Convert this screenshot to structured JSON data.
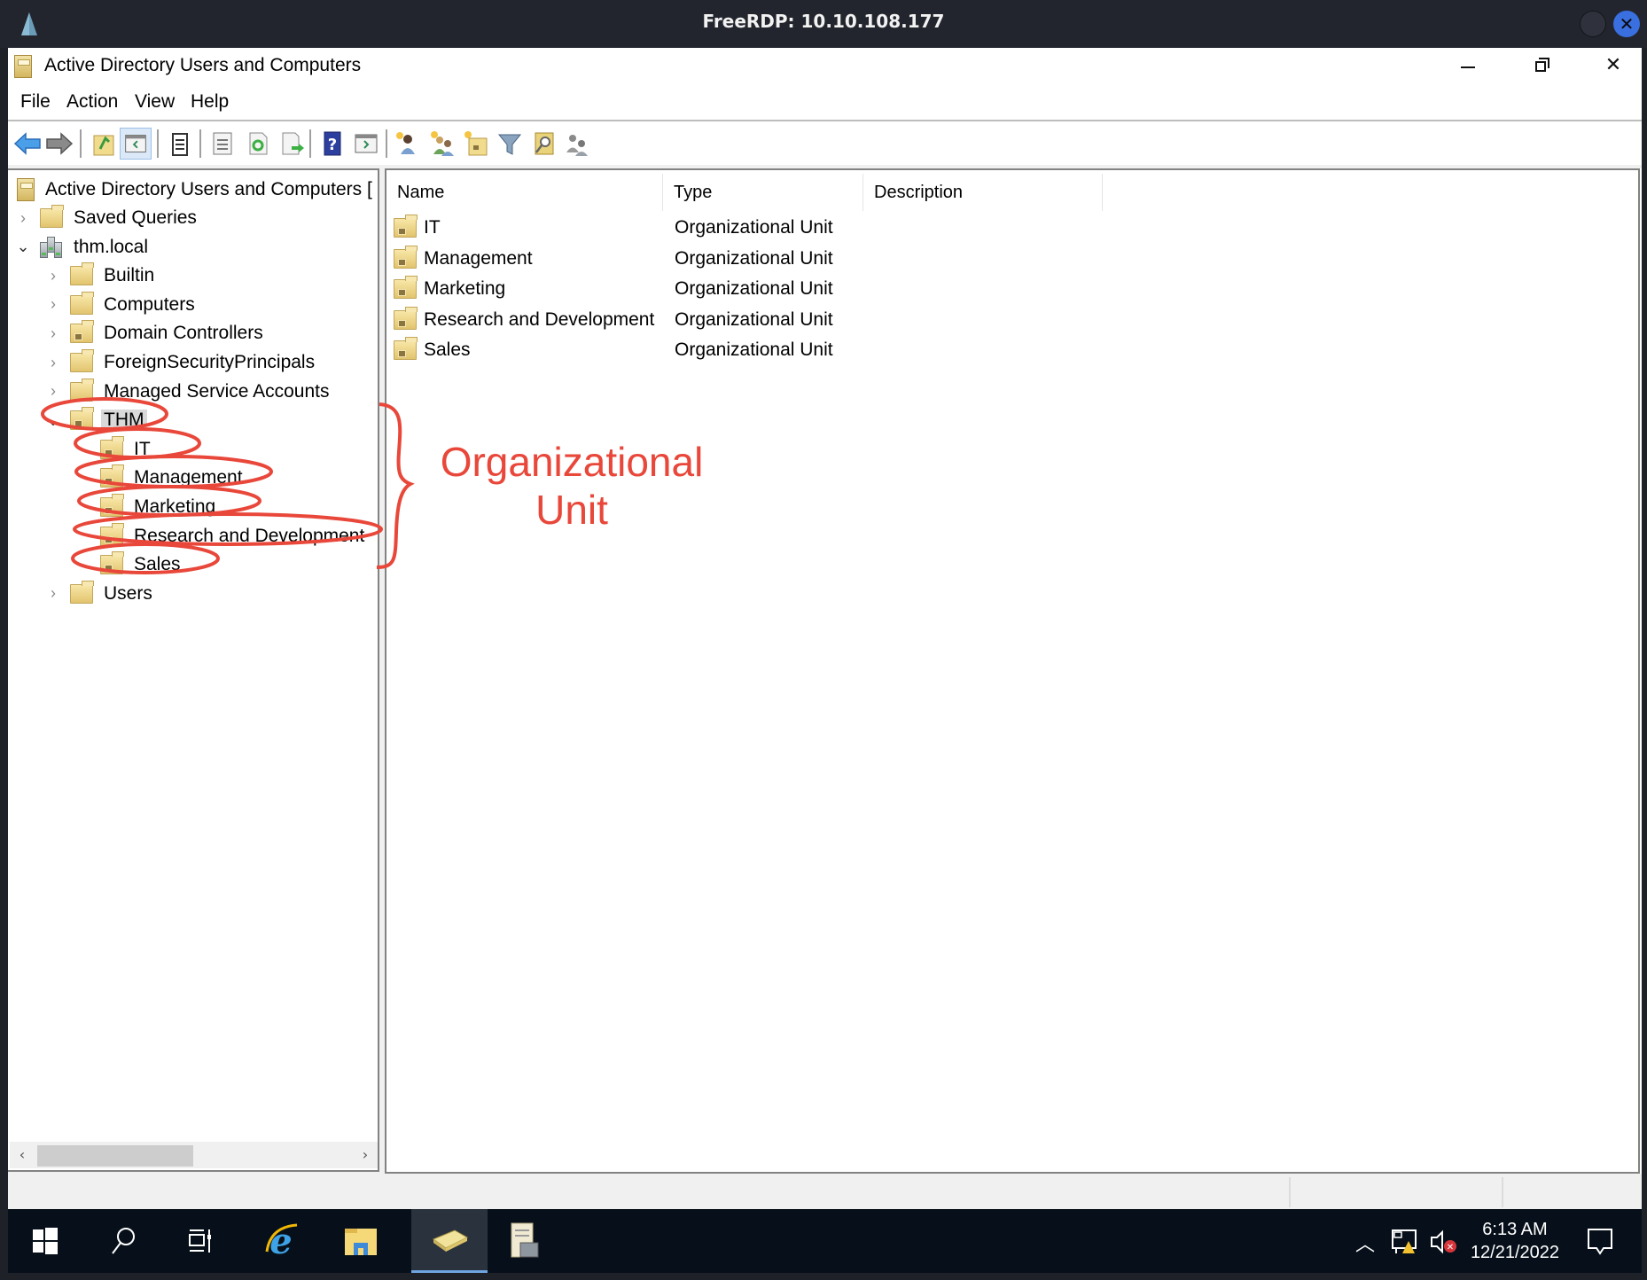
{
  "rdp": {
    "title": "FreeRDP: 10.10.108.177"
  },
  "window": {
    "title": "Active Directory Users and Computers",
    "controls": {
      "minimize": "minimize",
      "restore": "restore",
      "close": "close"
    }
  },
  "menu": [
    "File",
    "Action",
    "View",
    "Help"
  ],
  "toolbar": {
    "buttons": [
      "back-arrow",
      "forward-arrow",
      "up-folder",
      "show-hide-console-tree",
      "clipboard",
      "properties",
      "refresh",
      "export-list",
      "help",
      "show-hide-action-pane",
      "new-user",
      "new-group",
      "new-ou",
      "filter",
      "find",
      "add-to-group"
    ]
  },
  "tree": {
    "root": "Active Directory Users and Computers [",
    "items": [
      {
        "label": "Saved Queries",
        "level": 1,
        "expander": "collapsed",
        "icon": "folder"
      },
      {
        "label": "thm.local",
        "level": 1,
        "expander": "expanded",
        "icon": "domain"
      },
      {
        "label": "Builtin",
        "level": 2,
        "expander": "collapsed",
        "icon": "folder"
      },
      {
        "label": "Computers",
        "level": 2,
        "expander": "collapsed",
        "icon": "folder"
      },
      {
        "label": "Domain Controllers",
        "level": 2,
        "expander": "collapsed",
        "icon": "ou"
      },
      {
        "label": "ForeignSecurityPrincipals",
        "level": 2,
        "expander": "collapsed",
        "icon": "folder"
      },
      {
        "label": "Managed Service Accounts",
        "level": 2,
        "expander": "collapsed",
        "icon": "folder"
      },
      {
        "label": "THM",
        "level": 2,
        "expander": "expanded",
        "icon": "ou",
        "selected": true
      },
      {
        "label": "IT",
        "level": 3,
        "expander": "none",
        "icon": "ou"
      },
      {
        "label": "Management",
        "level": 3,
        "expander": "none",
        "icon": "ou"
      },
      {
        "label": "Marketing",
        "level": 3,
        "expander": "none",
        "icon": "ou"
      },
      {
        "label": "Research and Development",
        "level": 3,
        "expander": "none",
        "icon": "ou"
      },
      {
        "label": "Sales",
        "level": 3,
        "expander": "none",
        "icon": "ou"
      },
      {
        "label": "Users",
        "level": 2,
        "expander": "collapsed",
        "icon": "folder"
      }
    ]
  },
  "list": {
    "columns": [
      "Name",
      "Type",
      "Description"
    ],
    "rows": [
      {
        "name": "IT",
        "type": "Organizational Unit",
        "description": ""
      },
      {
        "name": "Management",
        "type": "Organizational Unit",
        "description": ""
      },
      {
        "name": "Marketing",
        "type": "Organizational Unit",
        "description": ""
      },
      {
        "name": "Research and Development",
        "type": "Organizational Unit",
        "description": ""
      },
      {
        "name": "Sales",
        "type": "Organizational Unit",
        "description": ""
      }
    ]
  },
  "annotation": {
    "label_line1": "Organizational",
    "label_line2": "Unit",
    "color": "#e8473a"
  },
  "taskbar": {
    "apps": [
      "start",
      "search",
      "task-view",
      "internet-explorer",
      "file-explorer",
      "active-directory-users-and-computers",
      "server-manager-notes"
    ],
    "active_app": "active-directory-users-and-computers",
    "time": "6:13 AM",
    "date": "12/21/2022"
  }
}
